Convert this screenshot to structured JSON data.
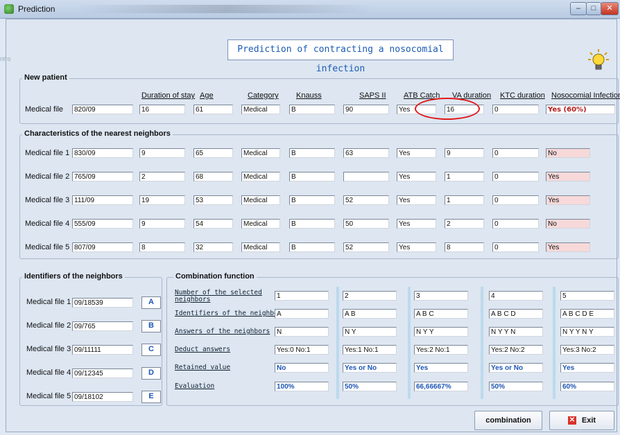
{
  "window": {
    "title": "Prediction",
    "minimize": "–",
    "maximize": "□",
    "close": "✕"
  },
  "banner": "Prediction of contracting a nosocomial infection",
  "side_text": "ntro",
  "new_patient": {
    "legend": "New patient",
    "headers": [
      "Duration of stay",
      "Age",
      "Category",
      "Knauss",
      "SAPS II",
      "ATB Catch",
      "VA duration",
      "KTC duration",
      "Nosocomial Infection"
    ],
    "label": "Medical file",
    "values": [
      "820/09",
      "16",
      "61",
      "Medical",
      "B",
      "90",
      "Yes",
      "16",
      "0",
      "Yes (60%)"
    ]
  },
  "neighbors": {
    "legend": "Characteristics of the nearest neighbors",
    "rows": [
      {
        "label": "Medical file 1",
        "values": [
          "830/09",
          "9",
          "65",
          "Medical",
          "B",
          "63",
          "Yes",
          "9",
          "0",
          "No"
        ]
      },
      {
        "label": "Medical file 2",
        "values": [
          "765/09",
          "2",
          "68",
          "Medical",
          "B",
          "",
          "Yes",
          "1",
          "0",
          "Yes"
        ]
      },
      {
        "label": "Medical file 3",
        "values": [
          "111/09",
          "19",
          "53",
          "Medical",
          "B",
          "52",
          "Yes",
          "1",
          "0",
          "Yes"
        ]
      },
      {
        "label": "Medical file 4",
        "values": [
          "555/09",
          "9",
          "54",
          "Medical",
          "B",
          "50",
          "Yes",
          "2",
          "0",
          "No"
        ]
      },
      {
        "label": "Medical file 5",
        "values": [
          "807/09",
          "8",
          "32",
          "Medical",
          "B",
          "52",
          "Yes",
          "8",
          "0",
          "Yes"
        ]
      }
    ]
  },
  "identifiers": {
    "legend": "Identifiers of the neighbors",
    "rows": [
      {
        "label": "Medical file 1",
        "value": "09/18539",
        "letter": "A"
      },
      {
        "label": "Medical file 2",
        "value": "09/765",
        "letter": "B"
      },
      {
        "label": "Medical file 3",
        "value": "09/11111",
        "letter": "C"
      },
      {
        "label": "Medical file 4",
        "value": "09/12345",
        "letter": "D"
      },
      {
        "label": "Medical file 5",
        "value": "09/18102",
        "letter": "E"
      }
    ]
  },
  "combination": {
    "legend": "Combination function",
    "row_labels": [
      "Number of the selected neighbors",
      "Identifiers of the neighbors",
      "Answers of the neighbors",
      "Deduct answers",
      "Retained value",
      "Evaluation"
    ],
    "columns": [
      [
        "1",
        "A",
        "N",
        "Yes:0  No:1",
        "No",
        "100%"
      ],
      [
        "2",
        "A B",
        "N Y",
        "Yes:1  No:1",
        "Yes or No",
        "50%"
      ],
      [
        "3",
        "A B C",
        "N Y Y",
        "Yes:2  No:1",
        "Yes",
        "66,66667%"
      ],
      [
        "4",
        "A B C D",
        "N Y Y N",
        "Yes:2  No:2",
        "Yes or No",
        "50%"
      ],
      [
        "5",
        "A B C D E",
        "N Y Y N Y",
        "Yes:3  No:2",
        "Yes",
        "60%"
      ]
    ]
  },
  "buttons": {
    "combination": "combination",
    "exit": "Exit"
  },
  "colors": {
    "accent_blue": "#1c55b5",
    "red": "#b31b1b",
    "pink_field": "#f7d9d9",
    "highlight_circle": "#e01818"
  }
}
